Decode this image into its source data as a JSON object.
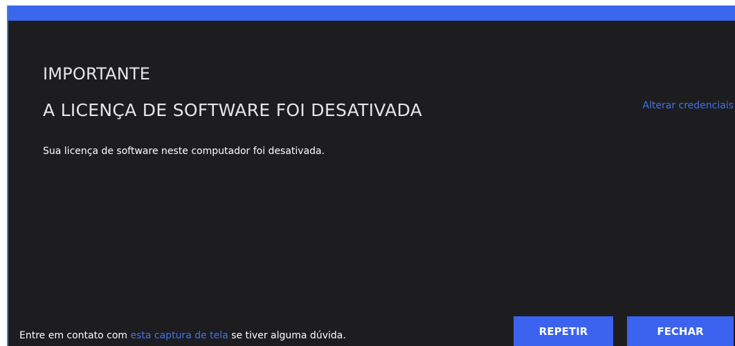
{
  "dialog": {
    "heading_small": "IMPORTANTE",
    "heading_main": "A LICENÇA DE SOFTWARE FOI DESATIVADA",
    "change_credentials_link": "Alterar credenciais",
    "message": "Sua licença de software neste computador foi desativada.",
    "footer": {
      "prefix": "Entre em contato com ",
      "link": "esta captura de tela",
      "suffix": " se tiver alguma dúvida."
    },
    "buttons": {
      "retry": "REPETIR",
      "close": "FECHAR"
    }
  },
  "colors": {
    "background": "#1d1d1f",
    "title_bar": "#3b66ee",
    "accent": "#3b63ef",
    "link": "#3f73f0"
  }
}
